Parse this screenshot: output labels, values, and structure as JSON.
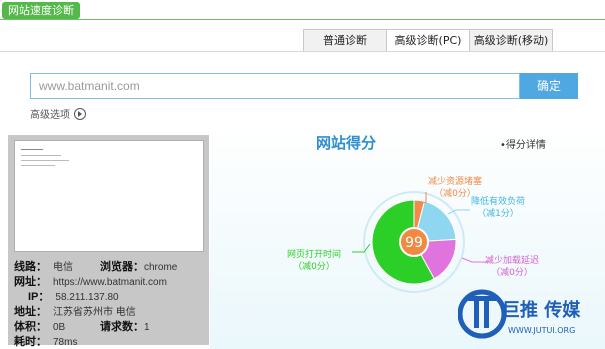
{
  "header": {
    "title": "网站速度诊断"
  },
  "tabs": [
    {
      "label": "普通诊断"
    },
    {
      "label": "高级诊断(PC)"
    },
    {
      "label": "高级诊断(移动)"
    }
  ],
  "search": {
    "placeholder": "www.batmanit.com",
    "confirm_label": "确定"
  },
  "advanced_options_label": "高级选项",
  "site_info": {
    "line_label": "线路：",
    "line_value": "电信",
    "browser_label": "浏览器：",
    "browser_value": "chrome",
    "url_label": "网址：",
    "url_value": "https://www.batmanit.com",
    "ip_label": "IP：",
    "ip_value": "58.211.137.80",
    "location_label": "地址：",
    "location_value": "江苏省苏州市 电信",
    "size_label": "体积：",
    "size_value": "0B",
    "requests_label": "请求数：",
    "requests_value": "1",
    "time_label": "耗时：",
    "time_value": "78ms"
  },
  "score": {
    "title": "网站得分",
    "detail_label": "•得分详情",
    "value": "99",
    "segments": [
      {
        "label": "减少资源堵塞",
        "sub": "（减0分）",
        "color": "#ef8a4a",
        "value": 4
      },
      {
        "label": "降低有效负荷",
        "sub": "（减1分）",
        "color": "#8fd6f0",
        "value": 20
      },
      {
        "label": "减少加载延迟",
        "sub": "（减0分）",
        "color": "#e173df",
        "value": 18
      },
      {
        "label": "网页打开时间",
        "sub": "（减0分）",
        "color": "#2ccf27",
        "value": 58
      }
    ]
  },
  "watermark": {
    "brand": "巨推 传媒",
    "url": "WWW.JUTUI.ORG"
  }
}
